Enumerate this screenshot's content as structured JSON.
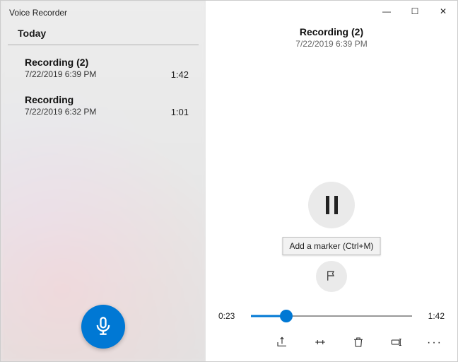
{
  "app": {
    "title": "Voice Recorder"
  },
  "window_controls": {
    "minimize": "—",
    "maximize": "☐",
    "close": "✕"
  },
  "sidebar": {
    "section": "Today",
    "items": [
      {
        "name": "Recording (2)",
        "datetime": "7/22/2019 6:39 PM",
        "duration": "1:42"
      },
      {
        "name": "Recording",
        "datetime": "7/22/2019 6:32 PM",
        "duration": "1:01"
      }
    ],
    "record_label": "Record"
  },
  "detail": {
    "title": "Recording (2)",
    "datetime": "7/22/2019 6:39 PM",
    "tooltip": "Add a marker (Ctrl+M)",
    "current_time": "0:23",
    "total_time": "1:42"
  },
  "toolbar": {
    "share": "Share",
    "trim": "Trim",
    "delete": "Delete",
    "rename": "Rename",
    "more": "···"
  }
}
